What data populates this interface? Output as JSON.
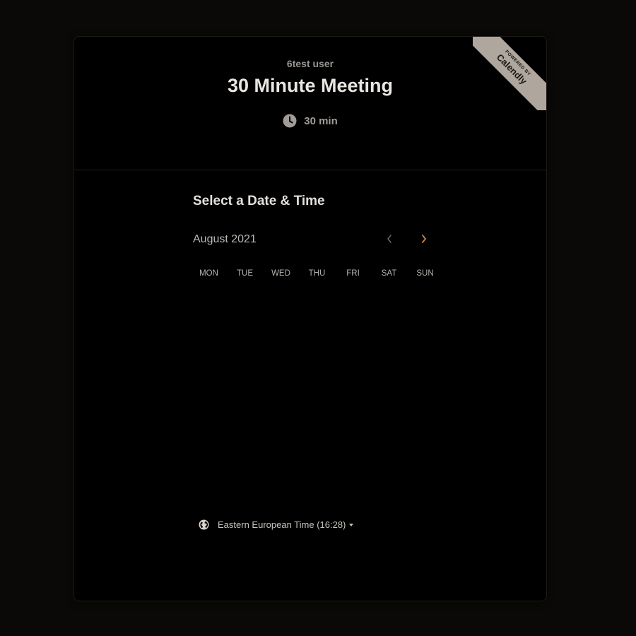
{
  "ribbon": {
    "powered_by": "POWERED BY",
    "brand": "Calendly"
  },
  "event": {
    "owner": "6test user",
    "title": "30 Minute Meeting",
    "duration": "30 min"
  },
  "scheduler": {
    "heading": "Select a Date & Time",
    "month": "August 2021",
    "weekdays": [
      "MON",
      "TUE",
      "WED",
      "THU",
      "FRI",
      "SAT",
      "SUN"
    ],
    "timezone": "Eastern European Time (16:28)"
  },
  "icons": {
    "duration": "clock-icon",
    "prev": "chevron-left-icon",
    "next": "chevron-right-icon",
    "timezone": "globe-icon",
    "timezone_dropdown": "caret-down-icon"
  },
  "colors": {
    "page_background": "#0a0907",
    "card_background": "#000000",
    "accent": "#d98c3e",
    "ribbon": "#afa69d",
    "disabled_nav": "#6b6661"
  }
}
